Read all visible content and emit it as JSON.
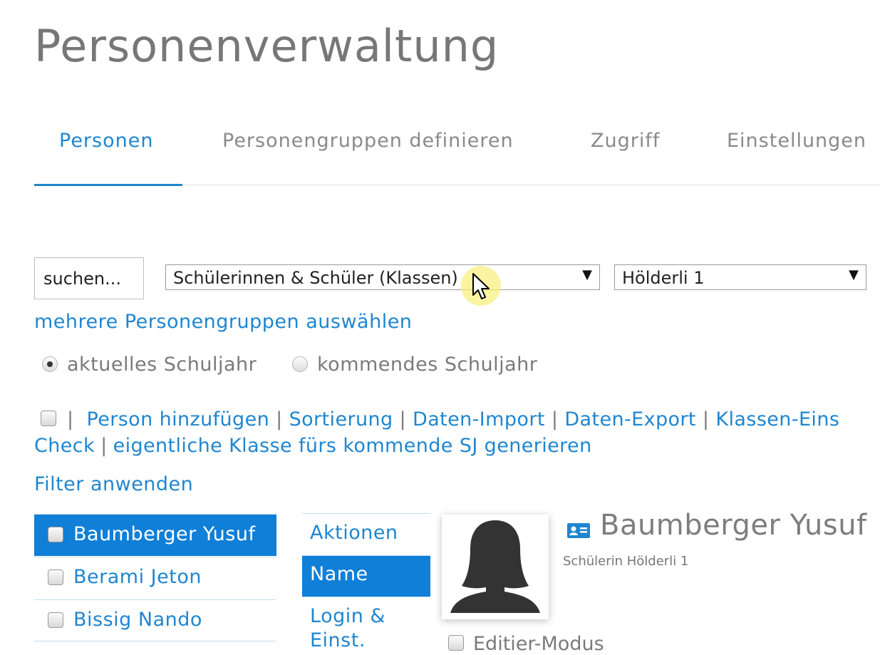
{
  "page": {
    "title": "Personenverwaltung"
  },
  "tabs": [
    {
      "label": "Personen",
      "active": true
    },
    {
      "label": "Personengruppen definieren",
      "active": false
    },
    {
      "label": "Zugriff",
      "active": false
    },
    {
      "label": "Einstellungen",
      "active": false
    }
  ],
  "filters": {
    "search_placeholder": "suchen...",
    "group_select": "Schülerinnen & Schüler (Klassen)",
    "class_select": "Hölderli 1",
    "multi_groups_link": "mehrere Personengruppen auswählen",
    "year_current": "aktuelles Schuljahr",
    "year_next": "kommendes Schuljahr",
    "year_selected": "current"
  },
  "actions": {
    "separator": "|",
    "add_person": "Person hinzufügen",
    "sorting": "Sortierung",
    "data_import": "Daten-Import",
    "data_export": "Daten-Export",
    "class_settings": "Klassen-Eins",
    "check": "Check",
    "generate_class": "eigentliche Klasse fürs kommende SJ generieren",
    "apply_filter": "Filter anwenden"
  },
  "people": [
    {
      "name": "Baumberger Yusuf",
      "selected": true
    },
    {
      "name": "Berami Jeton",
      "selected": false
    },
    {
      "name": "Bissig Nando",
      "selected": false
    }
  ],
  "detail_tabs": [
    {
      "label": "Aktionen",
      "selected": false
    },
    {
      "label": "Name",
      "selected": true
    },
    {
      "label": "Login & Einst.",
      "selected": false
    }
  ],
  "person_detail": {
    "name": "Baumberger Yusuf",
    "subtitle": "Schülerin Hölderli 1",
    "edit_mode_label": "Editier-Modus",
    "card_icon": "id-card-icon",
    "avatar_icon": "female-avatar-icon"
  },
  "colors": {
    "accent": "#1f86d0",
    "selected_bg": "#0f7fd8",
    "muted_text": "#7a7a7a"
  }
}
